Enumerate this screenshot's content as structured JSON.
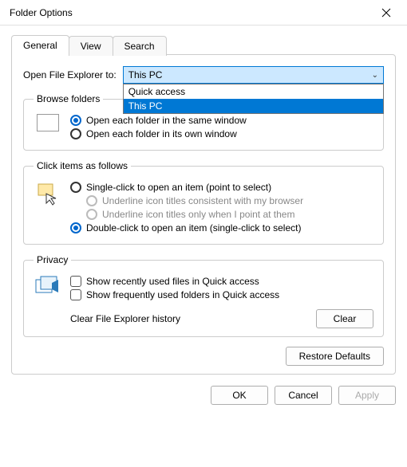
{
  "title": "Folder Options",
  "tabs": {
    "general": "General",
    "view": "View",
    "search": "Search"
  },
  "openExplorer": {
    "label": "Open File Explorer to:",
    "value": "This PC",
    "options": [
      "Quick access",
      "This PC"
    ]
  },
  "browse": {
    "legend": "Browse folders",
    "same": "Open each folder in the same window",
    "own": "Open each folder in its own window"
  },
  "click": {
    "legend": "Click items as follows",
    "single": "Single-click to open an item (point to select)",
    "ul_browser": "Underline icon titles consistent with my browser",
    "ul_point": "Underline icon titles only when I point at them",
    "double": "Double-click to open an item (single-click to select)"
  },
  "privacy": {
    "legend": "Privacy",
    "recent": "Show recently used files in Quick access",
    "frequent": "Show frequently used folders in Quick access",
    "clearLabel": "Clear File Explorer history",
    "clearBtn": "Clear"
  },
  "restore": "Restore Defaults",
  "buttons": {
    "ok": "OK",
    "cancel": "Cancel",
    "apply": "Apply"
  }
}
